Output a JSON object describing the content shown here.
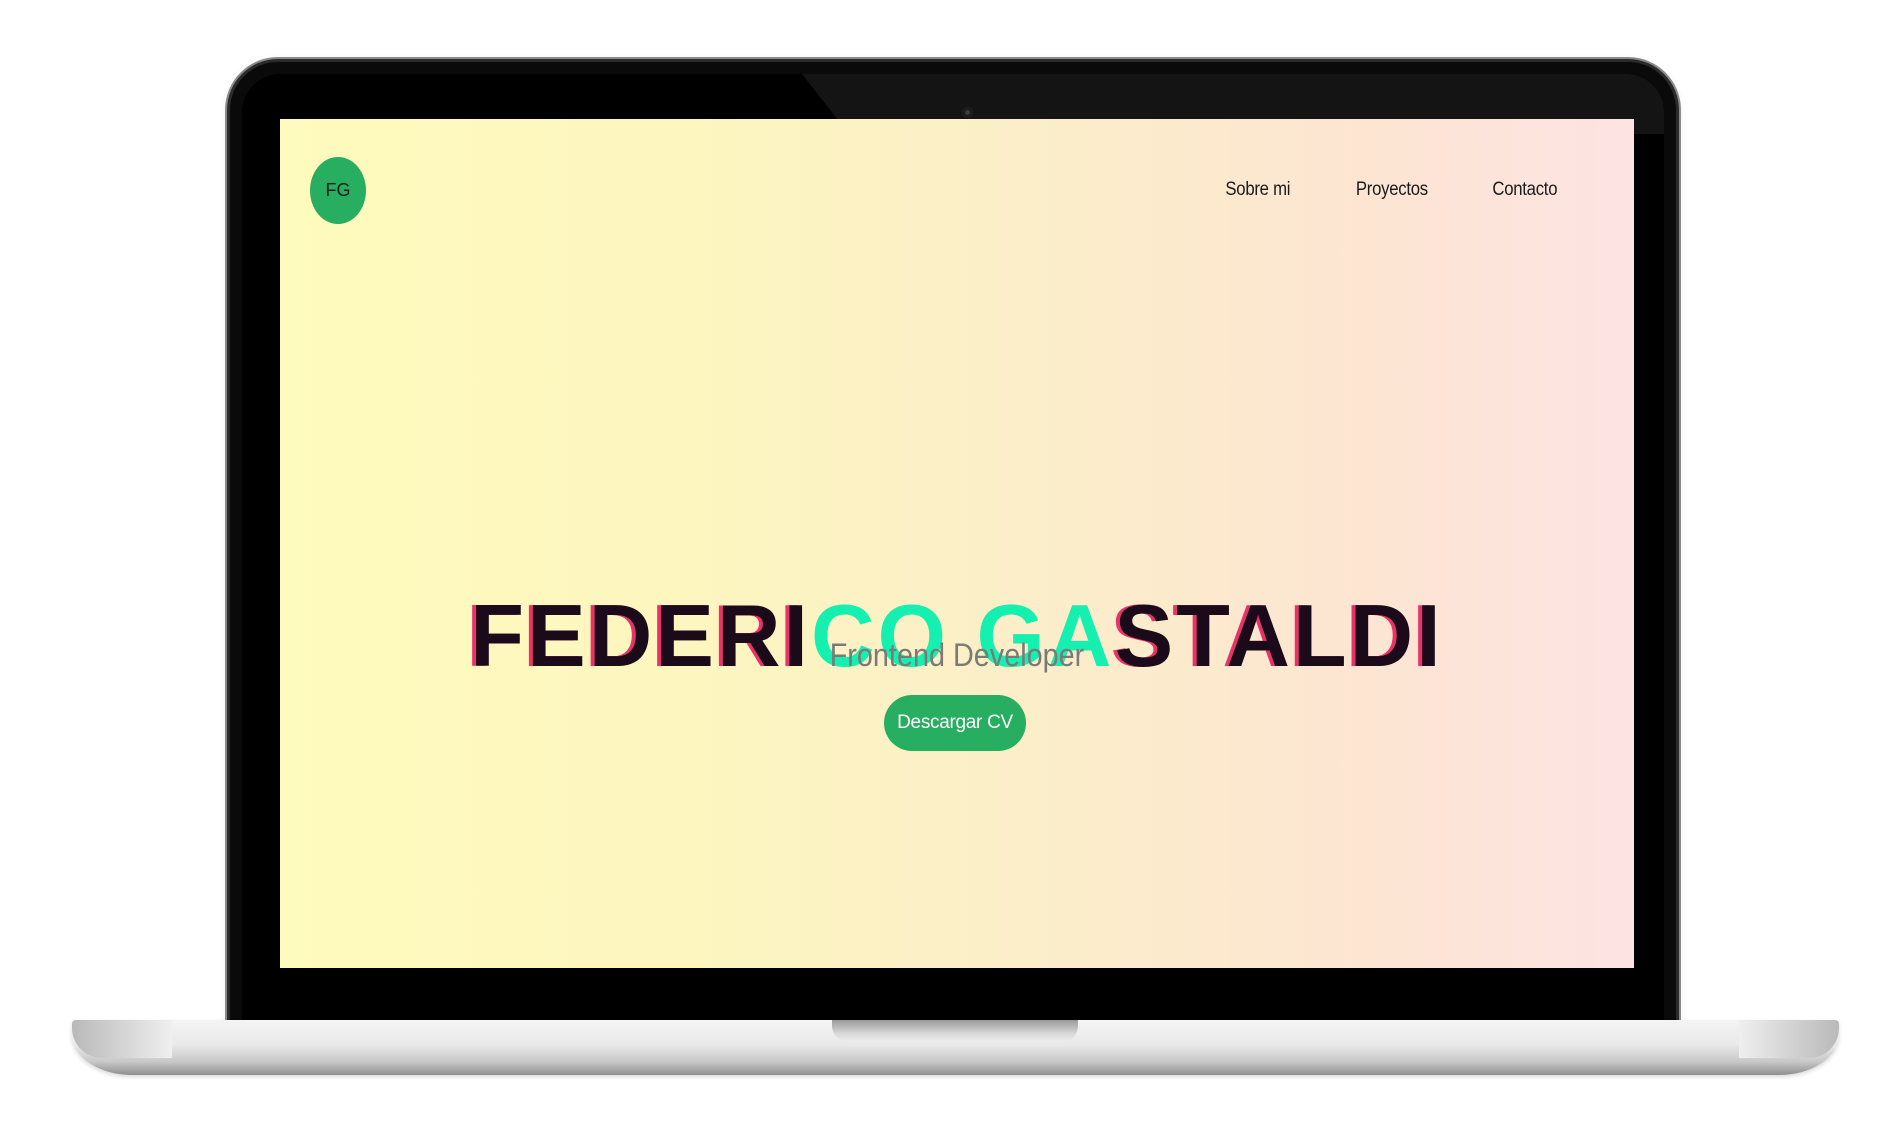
{
  "site": {
    "logo_text": "FG",
    "nav": {
      "items": [
        "Sobre mi",
        "Proyectos",
        "Contacto"
      ]
    },
    "hero": {
      "name_first": "FEDERICO",
      "name_last": "GASTALDI",
      "subtitle": "Frontend Developer",
      "cta_label": "Descargar CV"
    }
  },
  "colors": {
    "accent": "#27ae60",
    "glitch_cyan": "#15f0b0",
    "glitch_pink": "#e8336a",
    "title_dark": "#1a0a1a",
    "gradient_start": "#fefbbe",
    "gradient_end": "#fde3e3"
  },
  "icons": {
    "camera": "webcam-icon"
  }
}
